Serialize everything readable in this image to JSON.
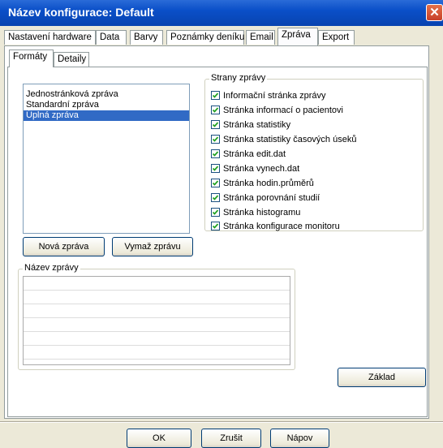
{
  "window": {
    "title": "Název konfigurace: Default",
    "close_symbol": "✕"
  },
  "tabs": [
    {
      "label": "Nastavení hardware"
    },
    {
      "label": "Data"
    },
    {
      "label": "Barvy"
    },
    {
      "label": "Poznámky deníku"
    },
    {
      "label": "Email"
    },
    {
      "label": "Zpráva",
      "active": true
    },
    {
      "label": "Export"
    }
  ],
  "subtabs": [
    {
      "label": "Formáty",
      "active": true
    },
    {
      "label": "Detaily"
    }
  ],
  "report_list": {
    "items": [
      {
        "label": "Jednostránková zpráva"
      },
      {
        "label": "Standardní zpráva"
      },
      {
        "label": "Úplná zpráva",
        "selected": true
      }
    ]
  },
  "buttons": {
    "new_report": "Nová zpráva",
    "delete_report": "Vymaž zprávu",
    "default": "Základ",
    "ok": "OK",
    "cancel": "Zrušit",
    "help": "Nápov"
  },
  "pages_group": {
    "legend": "Strany zprávy",
    "items": [
      {
        "label": "Informační stránka zprávy",
        "checked": true
      },
      {
        "label": "Stránka informací o pacientovi",
        "checked": true
      },
      {
        "label": "Stránka statistiky",
        "checked": true
      },
      {
        "label": "Stránka statistiky časových úseků",
        "checked": true
      },
      {
        "label": "Stránka edit.dat",
        "checked": true
      },
      {
        "label": "Stránka vynech.dat",
        "checked": true
      },
      {
        "label": "Stránka hodin.průměrů",
        "checked": true
      },
      {
        "label": "Stránka porovnání studií",
        "checked": true
      },
      {
        "label": "Stránka histogramu",
        "checked": true
      },
      {
        "label": "Stránka konfigurace monitoru",
        "checked": true
      }
    ]
  },
  "name_group": {
    "legend": "Název zprávy"
  }
}
